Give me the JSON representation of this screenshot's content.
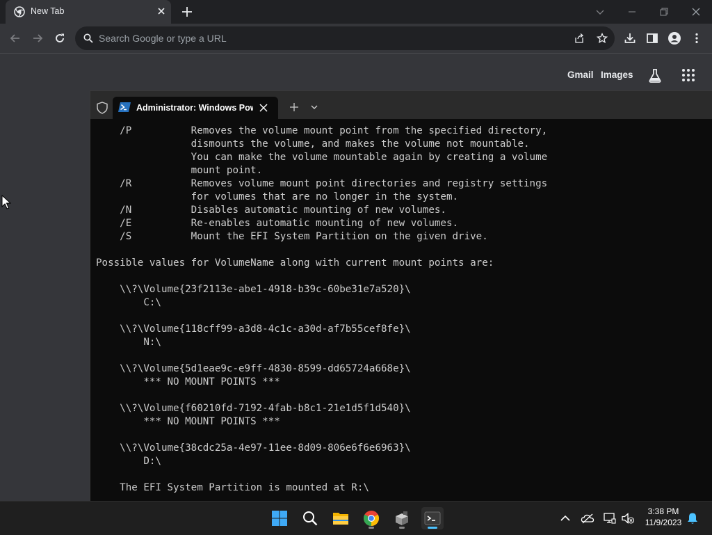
{
  "browser": {
    "tab_title": "New Tab",
    "omnibox_placeholder": "Search Google or type a URL",
    "links": {
      "gmail": "Gmail",
      "images": "Images"
    }
  },
  "terminal": {
    "tab_title": "Administrator: Windows PowerShell",
    "lines": [
      "    /P          Removes the volume mount point from the specified directory,",
      "                dismounts the volume, and makes the volume not mountable.",
      "                You can make the volume mountable again by creating a volume",
      "                mount point.",
      "    /R          Removes volume mount point directories and registry settings",
      "                for volumes that are no longer in the system.",
      "    /N          Disables automatic mounting of new volumes.",
      "    /E          Re-enables automatic mounting of new volumes.",
      "    /S          Mount the EFI System Partition on the given drive.",
      "",
      "Possible values for VolumeName along with current mount points are:",
      "",
      "    \\\\?\\Volume{23f2113e-abe1-4918-b39c-60be31e7a520}\\",
      "        C:\\",
      "",
      "    \\\\?\\Volume{118cff99-a3d8-4c1c-a30d-af7b55cef8fe}\\",
      "        N:\\",
      "",
      "    \\\\?\\Volume{5d1eae9c-e9ff-4830-8599-dd65724a668e}\\",
      "        *** NO MOUNT POINTS ***",
      "",
      "    \\\\?\\Volume{f60210fd-7192-4fab-b8c1-21e1d5f1d540}\\",
      "        *** NO MOUNT POINTS ***",
      "",
      "    \\\\?\\Volume{38cdc25a-4e97-11ee-8d09-806e6f6e6963}\\",
      "        D:\\",
      "",
      "    The EFI System Partition is mounted at R:\\"
    ]
  },
  "taskbar": {
    "apps": [
      "start-icon",
      "search-icon",
      "file-explorer-icon",
      "chrome-icon",
      "app-installer-icon",
      "terminal-icon"
    ],
    "time": "3:38 PM",
    "date": "11/9/2023"
  },
  "colors": {
    "terminal_bg": "#0c0c0c",
    "terminal_text": "#cccccc",
    "browser_bg": "#35363a",
    "accent": "#4cc2ff"
  }
}
